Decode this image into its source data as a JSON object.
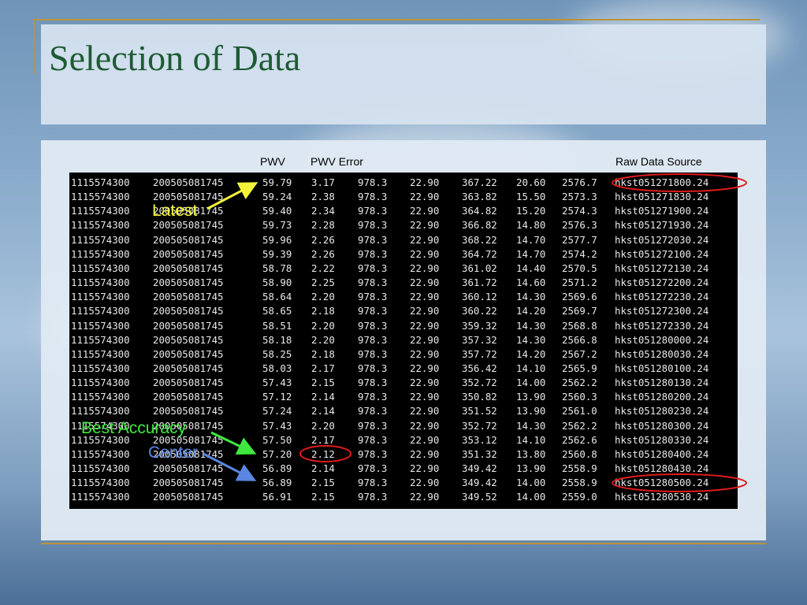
{
  "slide": {
    "title": "Selection of Data"
  },
  "columns": {
    "pwv": "PWV",
    "pwv_error": "PWV Error",
    "raw_source": "Raw Data Source"
  },
  "rows": [
    [
      "1115574300",
      "200505081745",
      "59.79",
      "3.17",
      "978.3",
      "22.90",
      "367.22",
      "20.60",
      "2576.7",
      "hkst051271800.24"
    ],
    [
      "1115574300",
      "200505081745",
      "59.24",
      "2.38",
      "978.3",
      "22.90",
      "363.82",
      "15.50",
      "2573.3",
      "hkst051271830.24"
    ],
    [
      "1115574300",
      "200505081745",
      "59.40",
      "2.34",
      "978.3",
      "22.90",
      "364.82",
      "15.20",
      "2574.3",
      "hkst051271900.24"
    ],
    [
      "1115574300",
      "200505081745",
      "59.73",
      "2.28",
      "978.3",
      "22.90",
      "366.82",
      "14.80",
      "2576.3",
      "hkst051271930.24"
    ],
    [
      "1115574300",
      "200505081745",
      "59.96",
      "2.26",
      "978.3",
      "22.90",
      "368.22",
      "14.70",
      "2577.7",
      "hkst051272030.24"
    ],
    [
      "1115574300",
      "200505081745",
      "59.39",
      "2.26",
      "978.3",
      "22.90",
      "364.72",
      "14.70",
      "2574.2",
      "hkst051272100.24"
    ],
    [
      "1115574300",
      "200505081745",
      "58.78",
      "2.22",
      "978.3",
      "22.90",
      "361.02",
      "14.40",
      "2570.5",
      "hkst051272130.24"
    ],
    [
      "1115574300",
      "200505081745",
      "58.90",
      "2.25",
      "978.3",
      "22.90",
      "361.72",
      "14.60",
      "2571.2",
      "hkst051272200.24"
    ],
    [
      "1115574300",
      "200505081745",
      "58.64",
      "2.20",
      "978.3",
      "22.90",
      "360.12",
      "14.30",
      "2569.6",
      "hkst051272230.24"
    ],
    [
      "1115574300",
      "200505081745",
      "58.65",
      "2.18",
      "978.3",
      "22.90",
      "360.22",
      "14.20",
      "2569.7",
      "hkst051272300.24"
    ],
    [
      "1115574300",
      "200505081745",
      "58.51",
      "2.20",
      "978.3",
      "22.90",
      "359.32",
      "14.30",
      "2568.8",
      "hkst051272330.24"
    ],
    [
      "1115574300",
      "200505081745",
      "58.18",
      "2.20",
      "978.3",
      "22.90",
      "357.32",
      "14.30",
      "2566.8",
      "hkst051280000.24"
    ],
    [
      "1115574300",
      "200505081745",
      "58.25",
      "2.18",
      "978.3",
      "22.90",
      "357.72",
      "14.20",
      "2567.2",
      "hkst051280030.24"
    ],
    [
      "1115574300",
      "200505081745",
      "58.03",
      "2.17",
      "978.3",
      "22.90",
      "356.42",
      "14.10",
      "2565.9",
      "hkst051280100.24"
    ],
    [
      "1115574300",
      "200505081745",
      "57.43",
      "2.15",
      "978.3",
      "22.90",
      "352.72",
      "14.00",
      "2562.2",
      "hkst051280130.24"
    ],
    [
      "1115574300",
      "200505081745",
      "57.12",
      "2.14",
      "978.3",
      "22.90",
      "350.82",
      "13.90",
      "2560.3",
      "hkst051280200.24"
    ],
    [
      "1115574300",
      "200505081745",
      "57.24",
      "2.14",
      "978.3",
      "22.90",
      "351.52",
      "13.90",
      "2561.0",
      "hkst051280230.24"
    ],
    [
      "1115574300",
      "200505081745",
      "57.43",
      "2.20",
      "978.3",
      "22.90",
      "352.72",
      "14.30",
      "2562.2",
      "hkst051280300.24"
    ],
    [
      "1115574300",
      "200505081745",
      "57.50",
      "2.17",
      "978.3",
      "22.90",
      "353.12",
      "14.10",
      "2562.6",
      "hkst051280330.24"
    ],
    [
      "1115574300",
      "200505081745",
      "57.20",
      "2.12",
      "978.3",
      "22.90",
      "351.32",
      "13.80",
      "2560.8",
      "hkst051280400.24"
    ],
    [
      "1115574300",
      "200505081745",
      "56.89",
      "2.14",
      "978.3",
      "22.90",
      "349.42",
      "13.90",
      "2558.9",
      "hkst051280430.24"
    ],
    [
      "1115574300",
      "200505081745",
      "56.89",
      "2.15",
      "978.3",
      "22.90",
      "349.42",
      "14.00",
      "2558.9",
      "hkst051280500.24"
    ],
    [
      "1115574300",
      "200505081745",
      "56.91",
      "2.15",
      "978.3",
      "22.90",
      "349.52",
      "14.00",
      "2559.0",
      "hkst051280530.24"
    ]
  ],
  "annotations": {
    "latest": {
      "label": "Latest",
      "color": "#f2f23a"
    },
    "best_accuracy": {
      "label": "Best Accuracy",
      "color": "#3ee83e"
    },
    "center": {
      "label": "Center",
      "color": "#5b86e0"
    }
  },
  "highlight_color": "#e01a1a"
}
